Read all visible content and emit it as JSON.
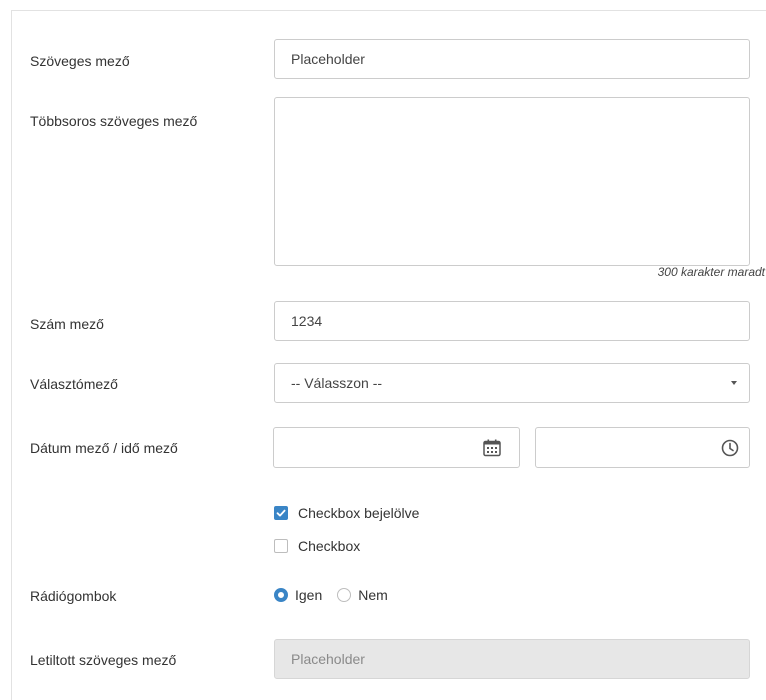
{
  "form": {
    "text_field": {
      "label": "Szöveges mező",
      "value": "Placeholder"
    },
    "textarea": {
      "label": "Többsoros szöveges mező",
      "value": "",
      "counter": "300 karakter maradt"
    },
    "number_field": {
      "label": "Szám mező",
      "value": "1234"
    },
    "select": {
      "label": "Választómező",
      "selected": "-- Válasszon --"
    },
    "datetime": {
      "label": "Dátum mező / idő mező",
      "date_value": "",
      "time_value": ""
    },
    "checkboxes": [
      {
        "label": "Checkbox bejelölve",
        "checked": true
      },
      {
        "label": "Checkbox",
        "checked": false
      }
    ],
    "radio": {
      "label": "Rádiógombok",
      "options": [
        {
          "label": "Igen",
          "selected": true
        },
        {
          "label": "Nem",
          "selected": false
        }
      ]
    },
    "disabled_field": {
      "label": "Letiltott  szöveges mező",
      "value": "Placeholder"
    }
  },
  "colors": {
    "accent": "#3a85c6",
    "border": "#cccccc",
    "disabled_bg": "#e7e7e7",
    "text": "#333333"
  },
  "icons": {
    "date": "calendar-icon",
    "time": "clock-icon",
    "select": "caret-down-icon"
  }
}
